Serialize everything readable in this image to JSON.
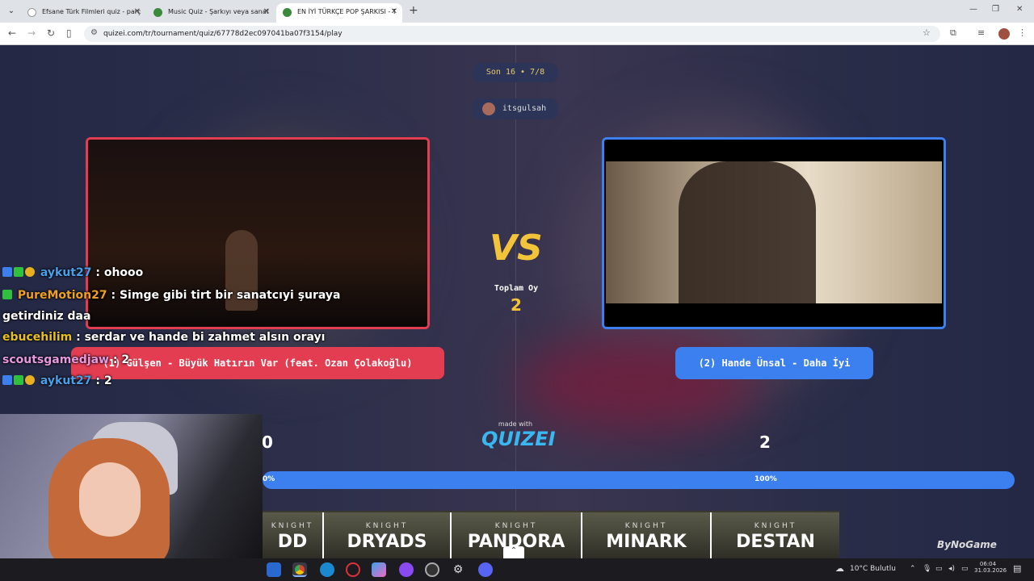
{
  "browser": {
    "tabs": [
      {
        "title": "Efsane Türk Filmleri quiz - parç",
        "fav_color": "#ffffff"
      },
      {
        "title": "Music Quiz - Şarkıyı veya sanat",
        "fav_color": "#3a8a3a"
      },
      {
        "title": "EN İYİ TÜRKÇE POP ŞARKISI - T",
        "fav_color": "#3a8a3a"
      }
    ],
    "url": "quizei.com/tr/tournament/quiz/67778d2ec097041ba07f3154/play"
  },
  "quiz": {
    "round": "Son 16 • 7/8",
    "user": "itsgulsah",
    "vs_label": "VS",
    "total_votes_label": "Toplam Oy",
    "total_votes": "2",
    "left_option": "(1) Gülşen - Büyük Hatırın Var (feat. Ozan Çolakoğlu)",
    "right_option": "(2) Hande Ünsal - Daha İyi",
    "left_score": "0",
    "right_score": "2",
    "left_pct": "0%",
    "right_pct": "100%",
    "made_with": "made with",
    "brand": "QUIZEI"
  },
  "chat": [
    {
      "user": "aykut27",
      "msg": ": ohooo",
      "color": "#4aa0e8",
      "badges": [
        "#3c80f0",
        "#30c040",
        "#e8b020"
      ]
    },
    {
      "user": "PureMotion27",
      "msg": ": Simge gibi tirt bir sanatcıyi şuraya",
      "color": "#f0a020",
      "badges": [
        "#30c040"
      ]
    },
    {
      "user": "",
      "msg": "getirdiniz daa",
      "color": "#ffffff",
      "badges": []
    },
    {
      "user": "ebucehilim",
      "msg": ": serdar ve hande bi zahmet alsın orayı",
      "color": "#e8c020",
      "badges": []
    },
    {
      "user": "scoutsgamedjaw",
      "msg": ": 2",
      "color": "#e89ae0",
      "badges": []
    },
    {
      "user": "aykut27",
      "msg": ": 2",
      "color": "#4aa0e8",
      "badges": [
        "#3c80f0",
        "#30c040",
        "#e8b020"
      ]
    }
  ],
  "ads": [
    {
      "small": "KNIGHT",
      "big": "DD"
    },
    {
      "small": "KNIGHT",
      "big": "DRYADS"
    },
    {
      "small": "KNIGHT",
      "big": "PANDORA"
    },
    {
      "small": "KNIGHT",
      "big": "MINARK"
    },
    {
      "small": "KNIGHT",
      "big": "DESTAN"
    }
  ],
  "watermark": "ByNoGame",
  "taskbar": {
    "weather": "10°C Bulutlu",
    "time": "06:04",
    "date": "31.03.2026"
  },
  "colors": {
    "left_accent": "#e33d52",
    "right_accent": "#3c80f0",
    "vs_yellow": "#f3c43a"
  }
}
